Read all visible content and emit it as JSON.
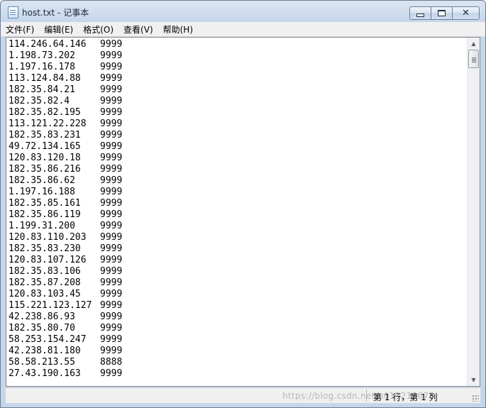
{
  "window": {
    "title": "host.txt - 记事本"
  },
  "menu": [
    "文件(F)",
    "编辑(E)",
    "格式(O)",
    "查看(V)",
    "帮助(H)"
  ],
  "lines": [
    {
      "ip": "114.246.64.146",
      "port": "9999"
    },
    {
      "ip": "1.198.73.202",
      "port": "9999"
    },
    {
      "ip": "1.197.16.178",
      "port": "9999"
    },
    {
      "ip": "113.124.84.88",
      "port": "9999"
    },
    {
      "ip": "182.35.84.21",
      "port": "9999"
    },
    {
      "ip": "182.35.82.4",
      "port": "9999"
    },
    {
      "ip": "182.35.82.195",
      "port": "9999"
    },
    {
      "ip": "113.121.22.228",
      "port": "9999"
    },
    {
      "ip": "182.35.83.231",
      "port": "9999"
    },
    {
      "ip": "49.72.134.165",
      "port": "9999"
    },
    {
      "ip": "120.83.120.18",
      "port": "9999"
    },
    {
      "ip": "182.35.86.216",
      "port": "9999"
    },
    {
      "ip": "182.35.86.62",
      "port": "9999"
    },
    {
      "ip": "1.197.16.188",
      "port": "9999"
    },
    {
      "ip": "182.35.85.161",
      "port": "9999"
    },
    {
      "ip": "182.35.86.119",
      "port": "9999"
    },
    {
      "ip": "1.199.31.200",
      "port": "9999"
    },
    {
      "ip": "120.83.110.203",
      "port": "9999"
    },
    {
      "ip": "182.35.83.230",
      "port": "9999"
    },
    {
      "ip": "120.83.107.126",
      "port": "9999"
    },
    {
      "ip": "182.35.83.106",
      "port": "9999"
    },
    {
      "ip": "182.35.87.208",
      "port": "9999"
    },
    {
      "ip": "120.83.103.45",
      "port": "9999"
    },
    {
      "ip": "115.221.123.127",
      "port": "9999"
    },
    {
      "ip": "42.238.86.93",
      "port": "9999"
    },
    {
      "ip": "182.35.80.70",
      "port": "9999"
    },
    {
      "ip": "58.253.154.247",
      "port": "9999"
    },
    {
      "ip": "42.238.81.180",
      "port": "9999"
    },
    {
      "ip": "58.58.213.55",
      "port": "8888"
    },
    {
      "ip": "27.43.190.163",
      "port": "9999"
    }
  ],
  "status": {
    "position": "第 1 行，第 1 列",
    "watermark": "https://blog.csdn.net/u013213673"
  },
  "icons": {
    "app": "notepad-icon",
    "minimize": "minimize-icon",
    "maximize": "maximize-icon",
    "close": "close-icon"
  }
}
